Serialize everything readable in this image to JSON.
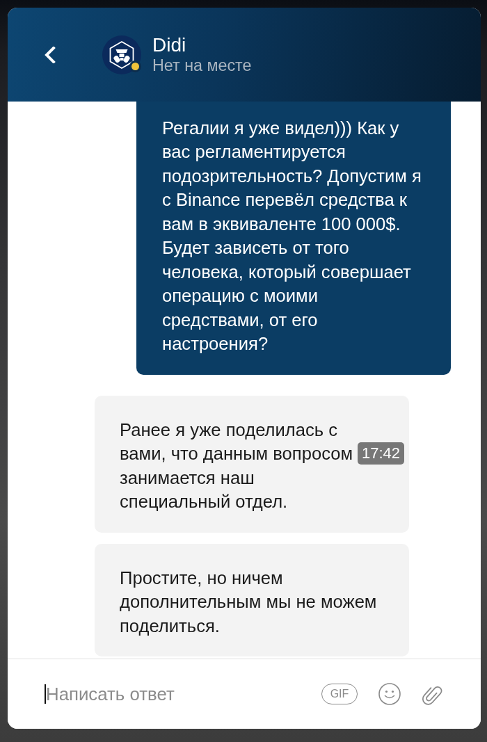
{
  "contact": {
    "name": "Didi",
    "status_text": "Нет на месте",
    "away": true
  },
  "messages": [
    {
      "kind": "outgoing",
      "text": "Регалии я уже видел))) Как у вас регламентируется подозрительность? Допустим я с Binance перевёл средства к вам в эквиваленте 100 000$. Будет зависеть от того человека, который совершает операцию с моими средствами, от его настроения?"
    },
    {
      "kind": "incoming",
      "text": "Ранее я уже поделилась с вами, что данным вопросом занимается наш специальный отдел.",
      "time": "17:42"
    },
    {
      "kind": "incoming",
      "text": "Простите, но ничем дополнительным мы не можем поделиться."
    }
  ],
  "composer": {
    "placeholder": "Написать ответ",
    "focused": true,
    "gif_label": "GIF"
  }
}
